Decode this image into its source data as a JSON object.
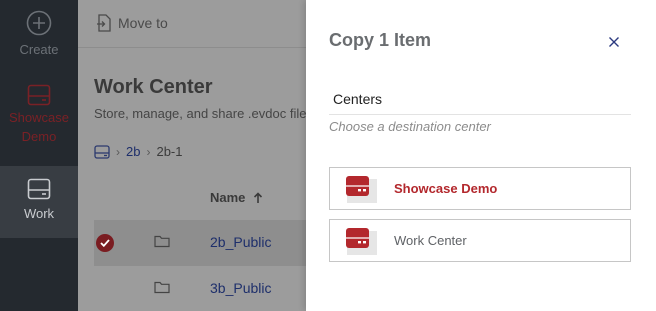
{
  "nav": {
    "items": [
      {
        "label": "Create",
        "icon": "plus-circle-icon"
      },
      {
        "label": "Showcase Demo",
        "icon": "drive-icon",
        "color": "#7a2126"
      },
      {
        "label": "Work",
        "icon": "drive-icon",
        "active": true
      }
    ]
  },
  "toolbar": {
    "move_to_label": "Move to"
  },
  "work_center": {
    "title": "Work Center",
    "subtitle": "Store, manage, and share .evdoc file"
  },
  "breadcrumb": {
    "items": [
      "2b",
      "2b-1"
    ]
  },
  "file_list": {
    "column_name": "Name",
    "rows": [
      {
        "name": "2b_Public",
        "selected": true
      },
      {
        "name": "3b_Public",
        "selected": false
      }
    ]
  },
  "dialog": {
    "title": "Copy 1 Item",
    "section_label": "Centers",
    "section_hint": "Choose a destination center",
    "options": [
      {
        "label": "Showcase Demo",
        "highlight": true
      },
      {
        "label": "Work Center",
        "highlight": false
      }
    ]
  },
  "colors": {
    "accent": "#b3282d",
    "nav_bg": "#24292f",
    "link": "#1e2f6b"
  }
}
